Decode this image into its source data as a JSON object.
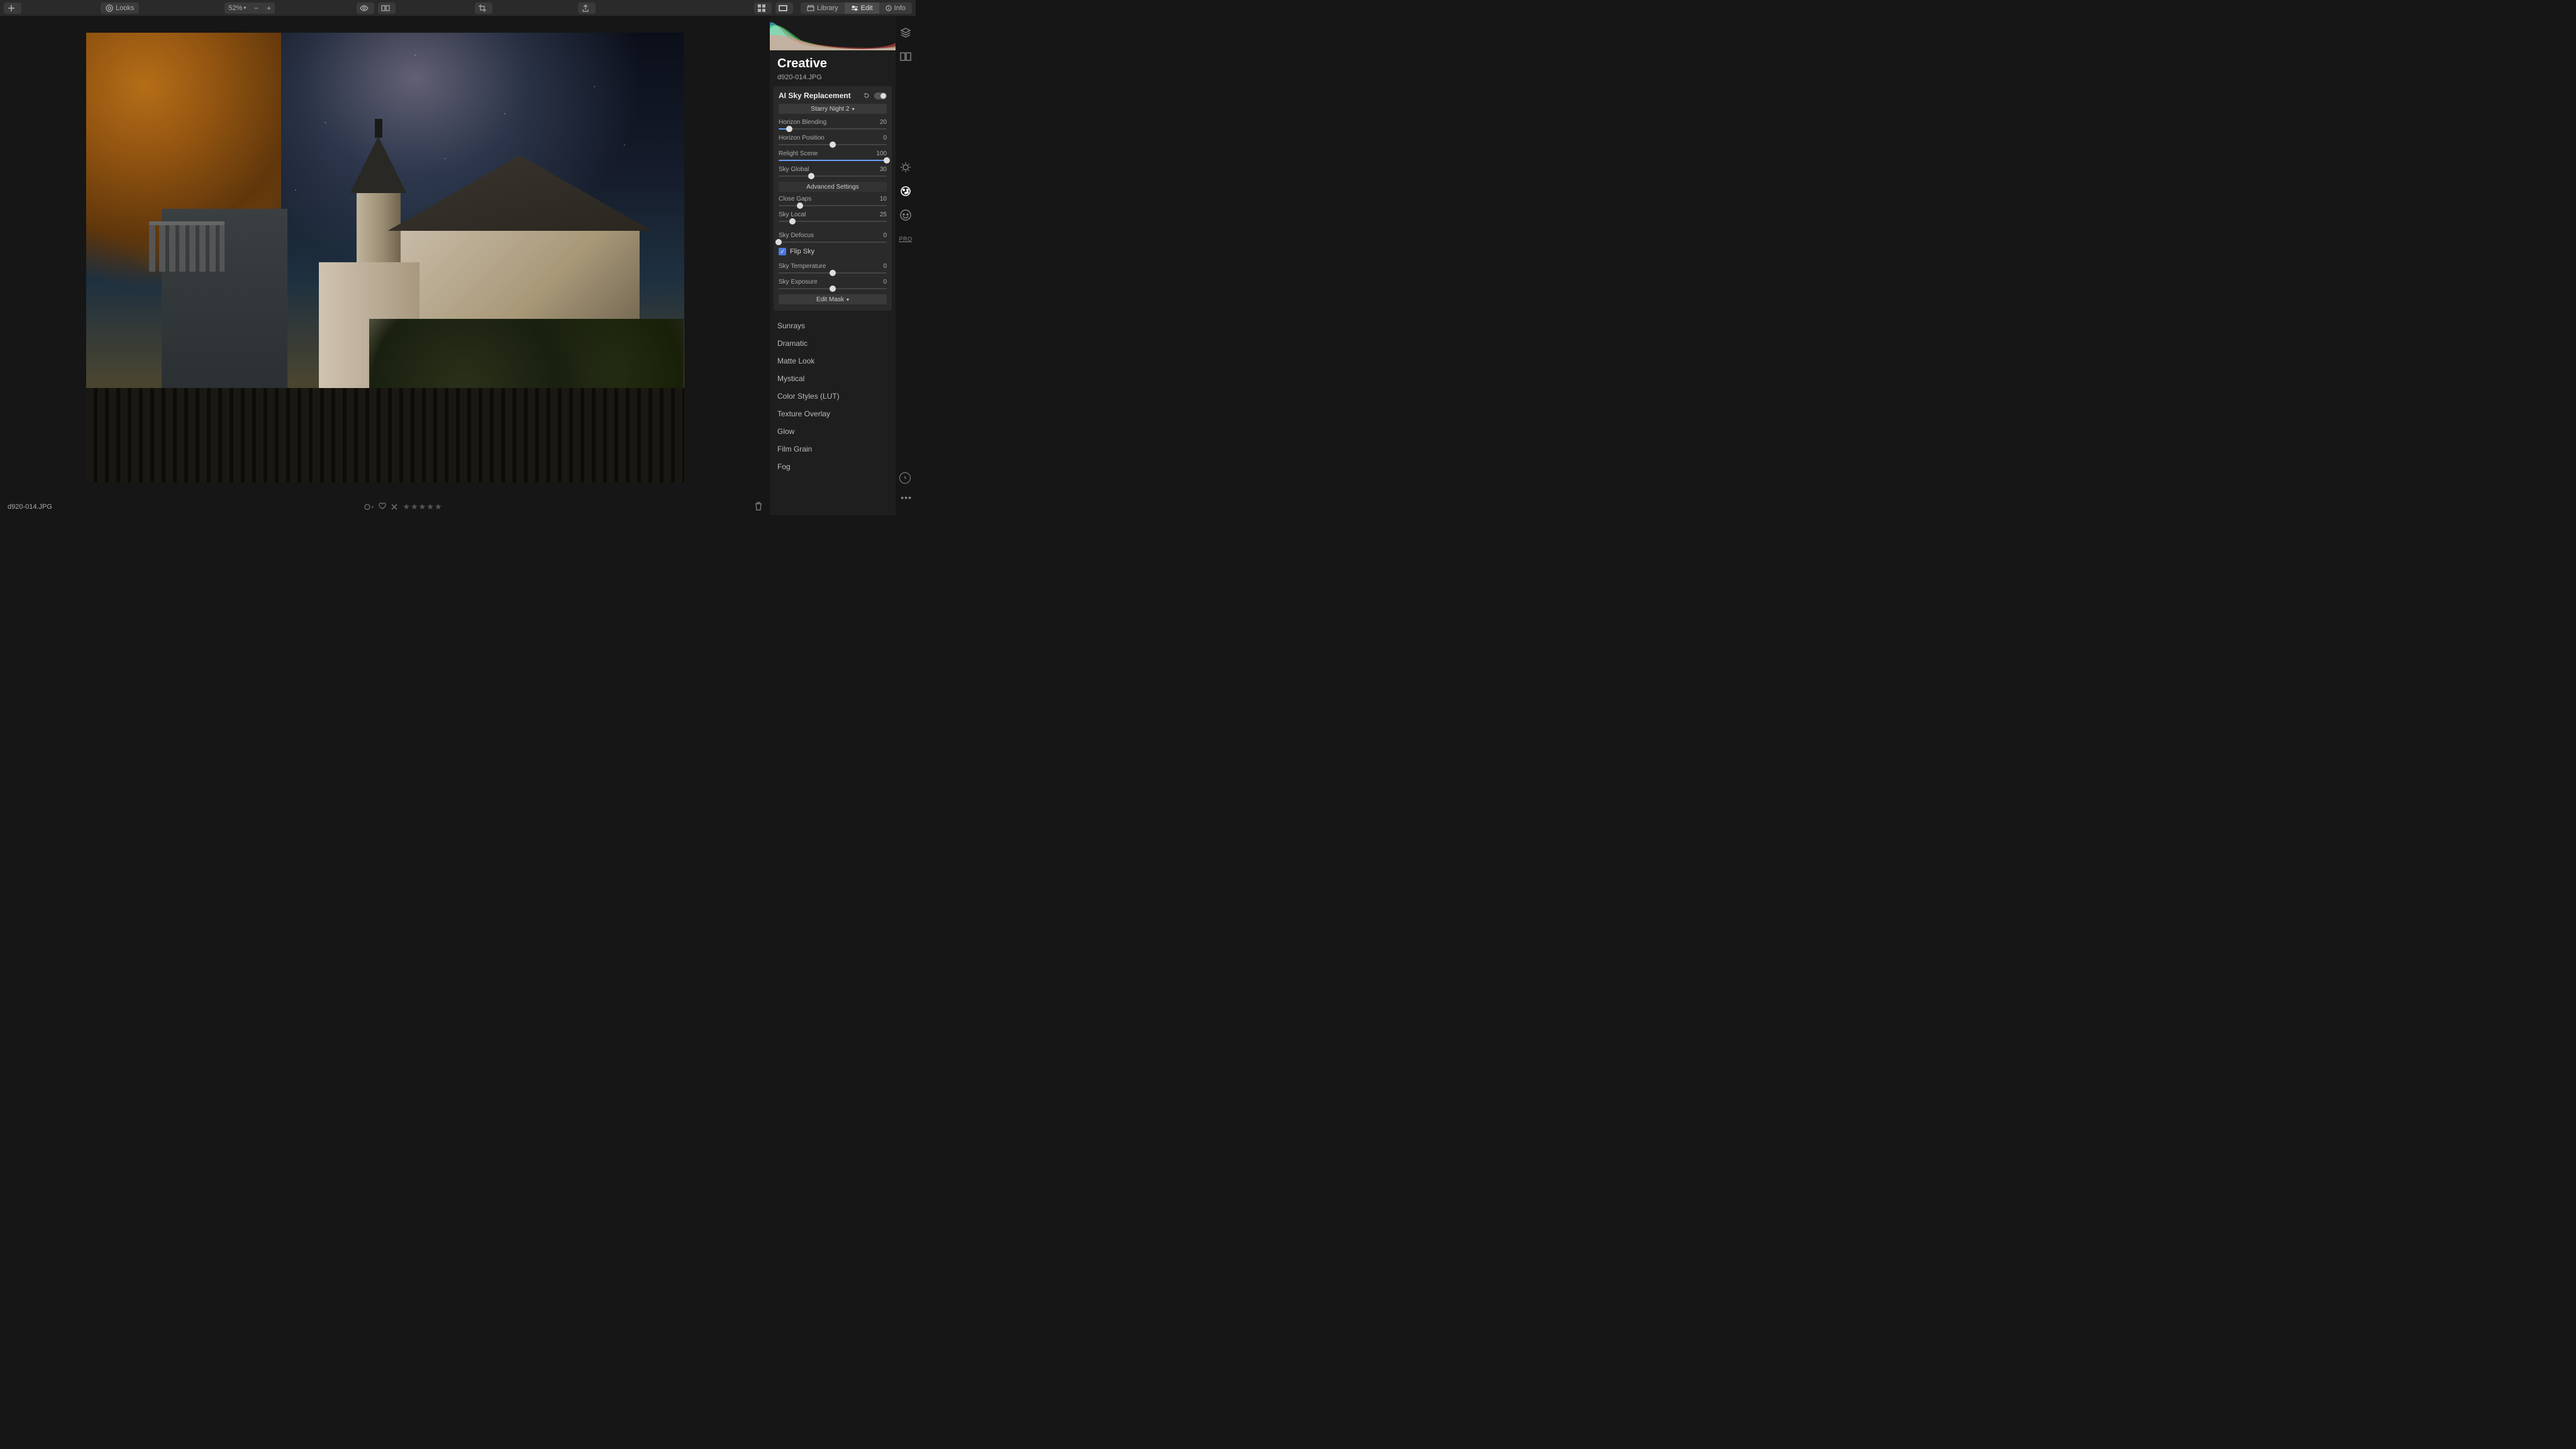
{
  "toolbar": {
    "looks_label": "Looks",
    "zoom_label": "52%",
    "tabs": {
      "library": "Library",
      "edit": "Edit",
      "info": "Info"
    }
  },
  "panel": {
    "title": "Creative",
    "filename": "d920-014.JPG",
    "tool": {
      "title": "AI Sky Replacement",
      "preset": "Starry Night 2",
      "sliders": {
        "horizon_blending": {
          "label": "Horizon Blending",
          "value": "20",
          "pct": 10
        },
        "horizon_position": {
          "label": "Horizon Position",
          "value": "0",
          "pct": 50
        },
        "relight_scene": {
          "label": "Relight Scene",
          "value": "100",
          "pct": 100
        },
        "sky_global": {
          "label": "Sky Global",
          "value": "30",
          "pct": 30
        },
        "close_gaps": {
          "label": "Close Gaps",
          "value": "10",
          "pct": 20
        },
        "sky_local": {
          "label": "Sky Local",
          "value": "25",
          "pct": 13
        },
        "sky_defocus": {
          "label": "Sky Defocus",
          "value": "0",
          "pct": 0
        },
        "sky_temperature": {
          "label": "Sky Temperature",
          "value": "0",
          "pct": 50
        },
        "sky_exposure": {
          "label": "Sky Exposure",
          "value": "0",
          "pct": 50
        }
      },
      "advanced_label": "Advanced Settings",
      "flip_sky_label": "Flip Sky",
      "flip_sky_checked": true,
      "edit_mask_label": "Edit Mask"
    },
    "tools_list": [
      "Sunrays",
      "Dramatic",
      "Matte Look",
      "Mystical",
      "Color Styles (LUT)",
      "Texture Overlay",
      "Glow",
      "Film Grain",
      "Fog"
    ],
    "side_pro": "PRO"
  },
  "footer": {
    "filename": "d920-014.JPG",
    "stars": "★★★★★"
  }
}
